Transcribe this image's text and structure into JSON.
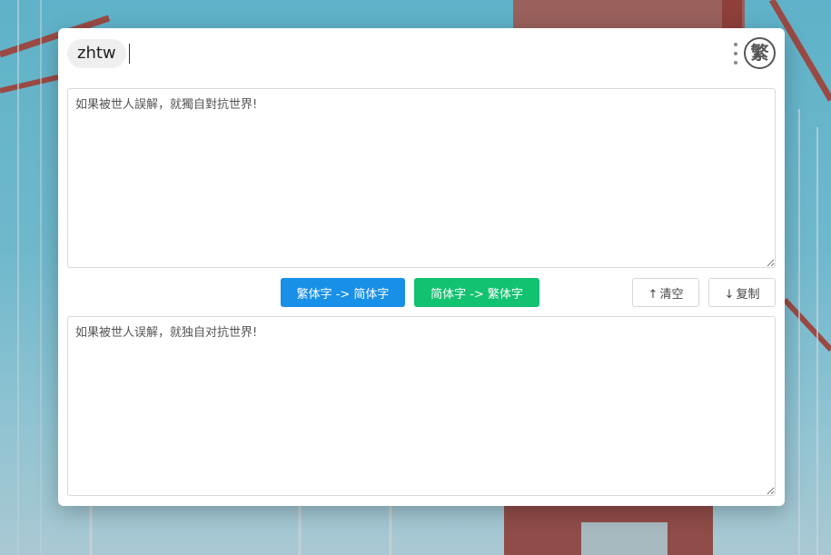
{
  "search": {
    "keyword": "zhtw"
  },
  "app": {
    "logo_char": "繁"
  },
  "input": {
    "value": "如果被世人誤解，就獨自對抗世界!"
  },
  "actions": {
    "to_simplified": "繁体字 -> 简体字",
    "to_traditional": "简体字 -> 繁体字",
    "clear_icon": "↑",
    "clear_label": "清空",
    "copy_icon": "↓",
    "copy_label": "复制"
  },
  "output": {
    "value": "如果被世人误解，就独自对抗世界!"
  },
  "colors": {
    "primary_blue": "#1890e8",
    "primary_green": "#13c270"
  }
}
